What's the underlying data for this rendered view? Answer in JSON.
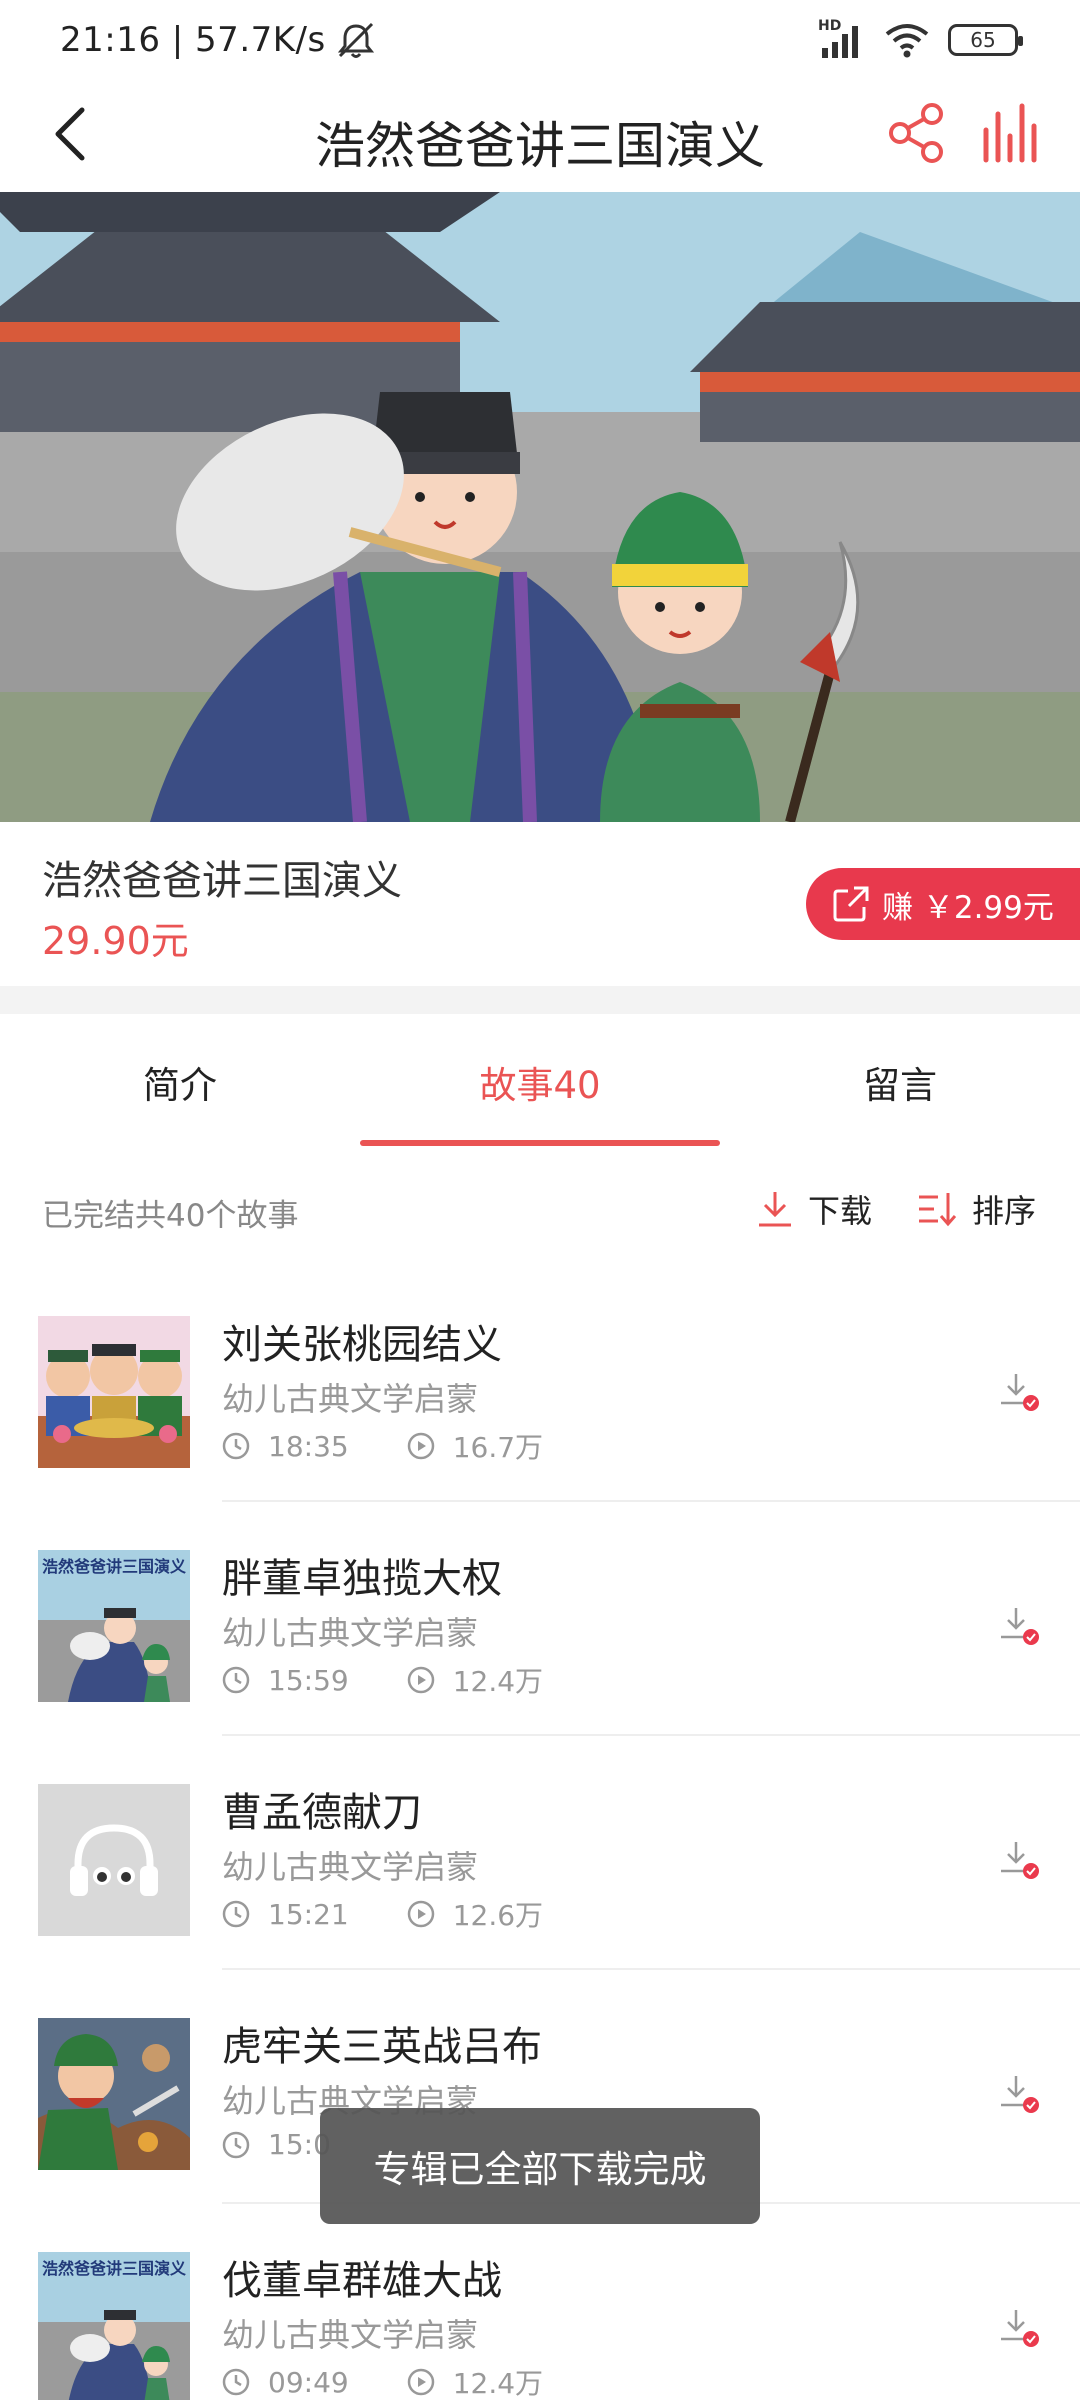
{
  "status_bar": {
    "time_speed": "21:16 | 57.7K/s",
    "network_label": "HD",
    "battery": "65"
  },
  "header": {
    "title": "浩然爸爸讲三国演义"
  },
  "album": {
    "name": "浩然爸爸讲三国演义",
    "price": "29.90元",
    "earn_label": "赚 ￥2.99元"
  },
  "tabs": [
    {
      "label": "简介",
      "active": false
    },
    {
      "label": "故事40",
      "active": true
    },
    {
      "label": "留言",
      "active": false
    }
  ],
  "list_header": {
    "summary": "已完结共40个故事",
    "download_label": "下载",
    "sort_label": "排序"
  },
  "stories": [
    {
      "title": "刘关张桃园结义",
      "subtitle": "幼儿古典文学启蒙",
      "duration": "18:35",
      "plays": "16.7万",
      "cover": "feast-cover"
    },
    {
      "title": "胖董卓独揽大权",
      "subtitle": "幼儿古典文学启蒙",
      "duration": "15:59",
      "plays": "12.4万",
      "cover": "album-cover"
    },
    {
      "title": "曹孟德献刀",
      "subtitle": "幼儿古典文学启蒙",
      "duration": "15:21",
      "plays": "12.6万",
      "cover": "placeholder-cover"
    },
    {
      "title": "虎牢关三英战吕布",
      "subtitle": "幼儿古典文学启蒙",
      "duration": "15:0",
      "plays": "",
      "cover": "battle-cover"
    },
    {
      "title": "伐董卓群雄大战",
      "subtitle": "幼儿古典文学启蒙",
      "duration": "09:49",
      "plays": "12.4万",
      "cover": "album-cover"
    }
  ],
  "cover_text": "浩然爸爸讲三国演义",
  "toast": "专辑已全部下载完成",
  "colors": {
    "accent": "#ea5454",
    "earn_button": "#e8394d",
    "toast_bg": "#555555"
  }
}
